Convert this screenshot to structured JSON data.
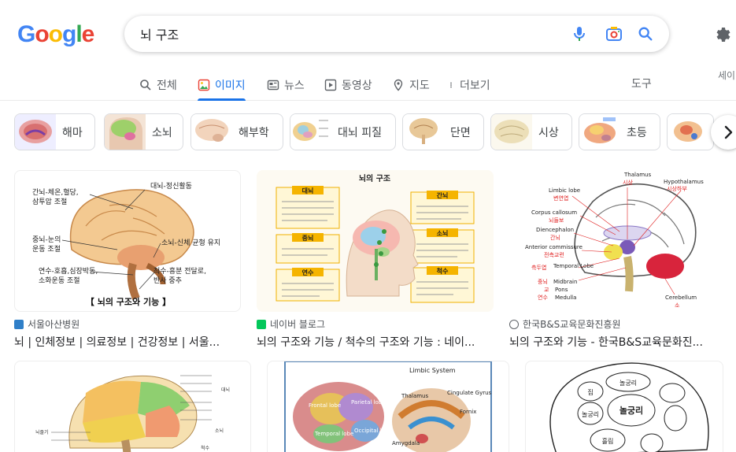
{
  "logo": "Google",
  "search": {
    "query": "뇌 구조"
  },
  "tabs": [
    {
      "label": "전체",
      "icon": "search-icon"
    },
    {
      "label": "이미지",
      "icon": "image-icon",
      "active": true
    },
    {
      "label": "뉴스",
      "icon": "news-icon"
    },
    {
      "label": "동영상",
      "icon": "video-icon"
    },
    {
      "label": "지도",
      "icon": "map-pin-icon"
    },
    {
      "label": "더보기",
      "icon": "more-vert-icon"
    }
  ],
  "tools_label": "도구",
  "safesearch_label": "세이",
  "chips": [
    {
      "label": "해마"
    },
    {
      "label": "소뇌"
    },
    {
      "label": "해부학"
    },
    {
      "label": "대뇌 피질"
    },
    {
      "label": "단면"
    },
    {
      "label": "시상"
    },
    {
      "label": "초등"
    }
  ],
  "results": [
    {
      "source": "서울아산병원",
      "title": "뇌 | 인체정보 | 의료정보 | 건강정보 | 서울...",
      "image_caption": "【 뇌의 구조와 기능 】",
      "image_labels": [
        "대뇌-정신활동",
        "간뇌-체온,혈당,",
        "삼투압 조절",
        "중뇌-눈의",
        "운동 조절",
        "소뇌-신체 균형 유지",
        "연수-호흡,심장박동,",
        "소화운동 조절",
        "척수-흥분 전달로,",
        "반사 중추"
      ]
    },
    {
      "source": "네이버 블로그",
      "title": "뇌의 구조와 기능 / 척수의 구조와 기능 : 네이...",
      "image_caption": "뇌의 구조",
      "image_labels": [
        "대뇌",
        "중뇌",
        "연수",
        "간뇌",
        "소뇌",
        "척수"
      ]
    },
    {
      "source": "한국B&S교육문화진흥원",
      "title": "뇌의 구조와 기능 - 한국B&S교육문화진...",
      "image_labels": [
        "Thalamus",
        "시상",
        "Hypothalamus",
        "시상하부",
        "Limbic lobe",
        "변연엽",
        "Corpus callosum",
        "뇌들보",
        "Diencephalon",
        "간뇌",
        "Anterior commissure",
        "전측교련",
        "측두엽",
        "Temporal Lobe",
        "중뇌",
        "Midbrain",
        "교",
        "Pons",
        "연수",
        "Medulla",
        "Cerebellum",
        "소"
      ]
    },
    {
      "image_labels": [
        "대뇌",
        "소뇌",
        "척수",
        "뇌줄기"
      ]
    },
    {
      "image_labels": [
        "Limbic System",
        "Thalamus",
        "Cingulate Gyrus",
        "Fornix",
        "Frontal lobe",
        "Parietal lobe",
        "Temporal lobe",
        "Occipital lobe",
        "Amygdala"
      ]
    },
    {
      "image_labels": [
        "놀궁리",
        "놀궁리",
        "놀궁리",
        "흘림",
        "집"
      ]
    }
  ]
}
